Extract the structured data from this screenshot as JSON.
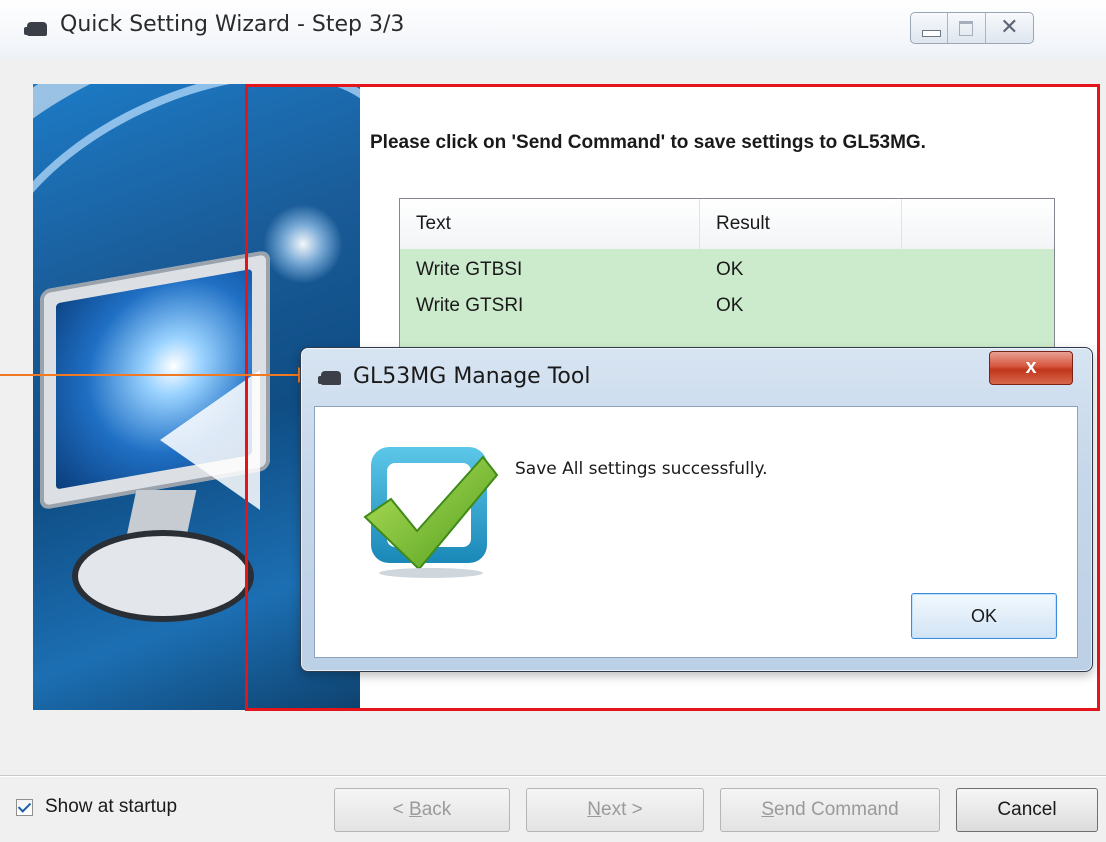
{
  "window": {
    "title": "Quick Setting Wizard - Step 3/3",
    "close_glyph": "✕"
  },
  "main": {
    "instruction": "Please click on 'Send Command' to save settings to GL53MG.",
    "table": {
      "headers": [
        "Text",
        "Result",
        ""
      ],
      "rows": [
        {
          "text": "Write GTBSI",
          "result": "OK"
        },
        {
          "text": "Write GTSRI",
          "result": "OK"
        }
      ]
    }
  },
  "footer": {
    "show_at_startup_label": "Show at startup",
    "show_at_startup_checked": true,
    "back_label": {
      "pre": "< ",
      "accel": "B",
      "post": "ack"
    },
    "next_label": {
      "pre": "",
      "accel": "N",
      "post": "ext >"
    },
    "send_label": {
      "pre": "",
      "accel": "S",
      "post": "end Command"
    },
    "cancel_label": "Cancel"
  },
  "dialog": {
    "title": "GL53MG Manage Tool",
    "close_glyph": "x",
    "message": "Save All settings successfully.",
    "ok_label": "OK"
  },
  "colors": {
    "highlight_frame": "#e3151b",
    "callout": "#f07921",
    "row_success": "#ccebcc"
  },
  "icons": {
    "app": "app-icon",
    "dialog_app": "app-icon",
    "success": "checkmark-icon"
  }
}
